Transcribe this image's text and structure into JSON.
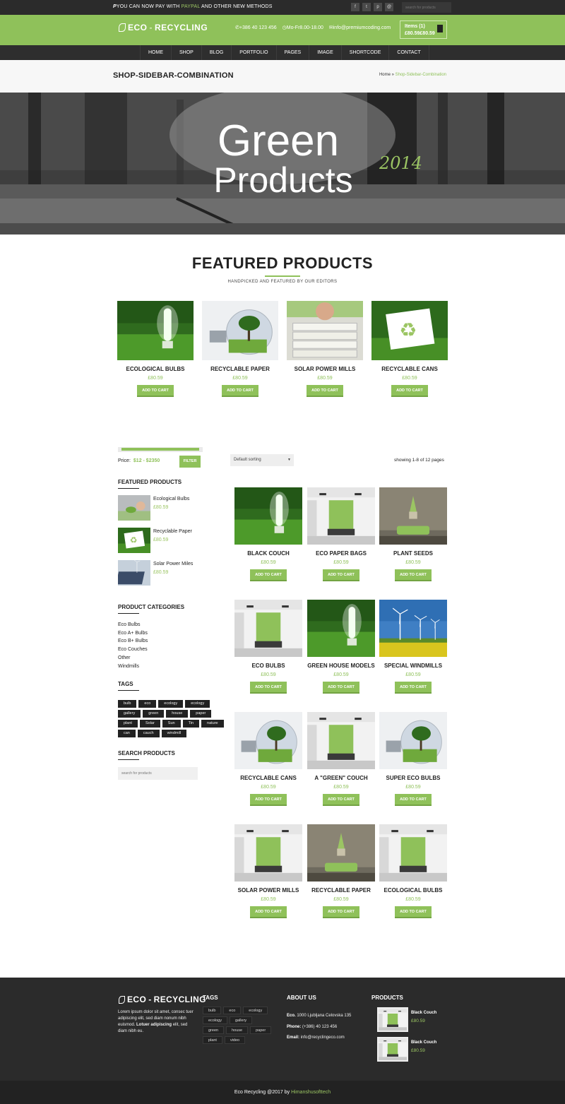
{
  "topbar": {
    "msg_prefix": "YOU CAN NOW PAY WITH ",
    "msg_paypal": "PAYPAL",
    "msg_suffix": " AND OTHER NEW METHODS",
    "social_icons": [
      "f",
      "t",
      "p",
      "@"
    ],
    "search_placeholder": "search for products"
  },
  "header": {
    "logo_left": "ECO",
    "logo_dot": "-",
    "logo_right": "RECYCLING",
    "phone": "+386 40 123 456",
    "hours": "Mo-Fr8.00-18.00",
    "email": "info@premiumcoding.com",
    "cart_items": "Items (1)",
    "cart_total": "£80.59£80.59"
  },
  "nav": [
    "HOME",
    "SHOP",
    "BLOG",
    "PORTFOLIO",
    "PAGES",
    "IMAGE",
    "SHORTCODE",
    "CONTACT"
  ],
  "titlebar": {
    "title": "SHOP-SIDEBAR-COMBINATION",
    "crumb_home": "Home",
    "crumb_sep": " » ",
    "crumb_current": "Shop-Sidebar-Combination"
  },
  "hero": {
    "line1": "Green",
    "line2": "Products",
    "year": "2014"
  },
  "featured": {
    "title": "FEATURED PRODUCTS",
    "subtitle": "HANDPICKED AND FEATURED BY OUR EDITORS",
    "items": [
      {
        "name": "ECOLOGICAL BULBS",
        "price": "£80.59",
        "button": "ADD TO CART",
        "image": "bulb-grass"
      },
      {
        "name": "RECYCLABLE PAPER",
        "price": "£80.59",
        "button": "ADD TO CART",
        "image": "lightbulb-tree"
      },
      {
        "name": "SOLAR POWER MILLS",
        "price": "£80.59",
        "button": "ADD TO CART",
        "image": "newspapers"
      },
      {
        "name": "RECYCLABLE CANS",
        "price": "£80.59",
        "button": "ADD TO CART",
        "image": "recycle-paper"
      }
    ]
  },
  "sidebar": {
    "price_label": "Price:",
    "price_range": "$12 - $2350",
    "filter_button": "FILTER",
    "featured_heading": "FEATURED PRODUCTS",
    "featured_items": [
      {
        "name": "Ecological Bulbs",
        "price": "£80.59",
        "image": "hand-plant"
      },
      {
        "name": "Recyclable Paper",
        "price": "£80.59",
        "image": "recycle-paper"
      },
      {
        "name": "Solar Power Miles",
        "price": "£80.59",
        "image": "solar-panels"
      }
    ],
    "categories_heading": "PRODUCT CATEGORIES",
    "categories": [
      "Eco Bulbs",
      "Eco A+ Bulbs",
      "Eco B+ Bulbs",
      "Eco Couches",
      "Other",
      "Windmills"
    ],
    "tags_heading": "TAGS",
    "tags": [
      "bulb",
      "eco",
      "ecology",
      "ecology",
      "gallery",
      "green",
      "house",
      "paper",
      "plant",
      "Solar",
      "Sun",
      "Tin",
      "nature",
      "can",
      "cauch",
      "windmill"
    ],
    "search_heading": "SEARCH PRODUCTS",
    "search_placeholder": "search for products"
  },
  "shop": {
    "sorting": "Default sorting",
    "showing": "showing 1-8 of 12 pages",
    "products": [
      {
        "name": "BLACK COUCH",
        "price": "£80.59",
        "button": "ADD TO CART",
        "image": "bulb-grass"
      },
      {
        "name": "ECO PAPER BAGS",
        "price": "£80.59",
        "button": "ADD TO CART",
        "image": "room-green"
      },
      {
        "name": "PLANT SEEDS",
        "price": "£80.59",
        "button": "ADD TO CART",
        "image": "sofa-green"
      },
      {
        "name": "ECO BULBS",
        "price": "£80.59",
        "button": "ADD TO CART",
        "image": "room-green"
      },
      {
        "name": "GREEN HOUSE MODELS",
        "price": "£80.59",
        "button": "ADD TO CART",
        "image": "bulb-grass"
      },
      {
        "name": "SPECIAL WINDMILLS",
        "price": "£80.59",
        "button": "ADD TO CART",
        "image": "windmills"
      },
      {
        "name": "RECYCLABLE CANS",
        "price": "£80.59",
        "button": "ADD TO CART",
        "image": "lightbulb-tree"
      },
      {
        "name": "A \"GREEN\" COUCH",
        "price": "£80.59",
        "button": "ADD TO CART",
        "image": "room-green"
      },
      {
        "name": "SUPER ECO BULBS",
        "price": "£80.59",
        "button": "ADD TO CART",
        "image": "lightbulb-tree"
      },
      {
        "name": "SOLAR POWER MILLS",
        "price": "£80.59",
        "button": "ADD TO CART",
        "image": "room-green"
      },
      {
        "name": "RECYCLABLE PAPER",
        "price": "£80.59",
        "button": "ADD TO CART",
        "image": "sofa-green"
      },
      {
        "name": "ECOLOGICAL BULBS",
        "price": "£80.59",
        "button": "ADD TO CART",
        "image": "room-green"
      }
    ]
  },
  "footer": {
    "logo_left": "ECO",
    "logo_dot": "-",
    "logo_right": "RECYCLING",
    "text_plain": "Lorem ipsum dolor sit amet, consec tuer adipiscing elit, sed diam nonum nibh euismod. ",
    "text_bold": "Lotuer adipiscing",
    "text_end": " elit, sed diam nibh eu.",
    "tags_heading": "TAGS",
    "tags": [
      "bulb",
      "eco",
      "ecology",
      "ecology",
      "gallery",
      "green",
      "house",
      "paper",
      "plant",
      "video"
    ],
    "about_heading": "ABOUT US",
    "about_company_label": "Eco.",
    "about_address": " 1000 Ljubljana Celovska 135",
    "about_phone_label": "Phone:",
    "about_phone": " (+386) 40 123 456",
    "about_email_label": "Email:",
    "about_email": " info@recyclingeco.com",
    "products_heading": "PRODUCTS",
    "products": [
      {
        "name": "Black Couch",
        "price": "£80.59",
        "image": "room-green"
      },
      {
        "name": "Black Couch",
        "price": "£80.59",
        "image": "room-green"
      }
    ],
    "copyright": "Eco Recycling @2017 by ",
    "author": "Himanshusofttech"
  },
  "colors": {
    "accent": "#8fc15a",
    "dark": "#2b2b2b",
    "price": "#8fc15a"
  }
}
